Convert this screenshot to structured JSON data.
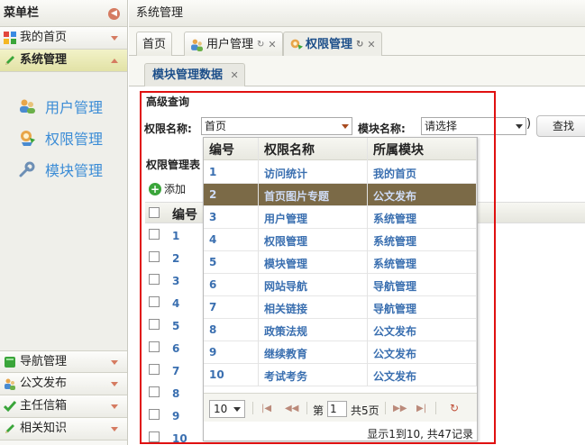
{
  "sidebar": {
    "title": "菜单栏",
    "sections": [
      {
        "label": "我的首页",
        "icon": "grid-icon"
      },
      {
        "label": "系统管理",
        "icon": "pencil-icon",
        "active": true
      }
    ],
    "sub_items": [
      {
        "label": "用户管理",
        "icon": "users-icon"
      },
      {
        "label": "权限管理",
        "icon": "permission-icon"
      },
      {
        "label": "模块管理",
        "icon": "wrench-icon"
      }
    ],
    "bottom_sections": [
      {
        "label": "导航管理",
        "icon": "book-icon"
      },
      {
        "label": "公文发布",
        "icon": "users-icon"
      },
      {
        "label": "主任信箱",
        "icon": "check-icon"
      },
      {
        "label": "相关知识",
        "icon": "pencil-icon"
      }
    ]
  },
  "main": {
    "title": "系统管理",
    "tabs": [
      {
        "label": "首页",
        "active": false
      },
      {
        "label": "用户管理",
        "active": false,
        "refresh": "↻",
        "close": "✕"
      },
      {
        "label": "权限管理",
        "active": true,
        "refresh": "↻",
        "close": "✕"
      }
    ],
    "subtab": {
      "label": "模块管理数据",
      "close": "✕"
    },
    "query": {
      "title": "高级查询",
      "permission_label": "权限名称:",
      "permission_value": "首页",
      "module_label": "模块名称:",
      "module_value": "请选择",
      "find_label": "查找"
    },
    "grid": {
      "title": "权限管理表",
      "add_label": "添加",
      "header_no": "编号",
      "row_numbers": [
        "1",
        "2",
        "3",
        "4",
        "5",
        "6",
        "7",
        "8",
        "9",
        "10"
      ]
    }
  },
  "dropdown": {
    "headers": [
      "编号",
      "权限名称",
      "所属模块"
    ],
    "rows": [
      {
        "id": "1",
        "name": "访问统计",
        "module": "我的首页"
      },
      {
        "id": "2",
        "name": "首页图片专题",
        "module": "公文发布",
        "selected": true
      },
      {
        "id": "3",
        "name": "用户管理",
        "module": "系统管理"
      },
      {
        "id": "4",
        "name": "权限管理",
        "module": "系统管理"
      },
      {
        "id": "5",
        "name": "模块管理",
        "module": "系统管理"
      },
      {
        "id": "6",
        "name": "网站导航",
        "module": "导航管理"
      },
      {
        "id": "7",
        "name": "相关链接",
        "module": "导航管理"
      },
      {
        "id": "8",
        "name": "政策法规",
        "module": "公文发布"
      },
      {
        "id": "9",
        "name": "继续教育",
        "module": "公文发布"
      },
      {
        "id": "10",
        "name": "考试考务",
        "module": "公文发布"
      }
    ],
    "pager": {
      "page_size": "10",
      "page_prefix": "第",
      "page_value": "1",
      "page_total": "共5页",
      "info": "显示1到10, 共47记录"
    }
  },
  "colors": {
    "accent": "#3b8cd6",
    "highlight_frame": "#e01010",
    "selected_row": "#7b6a47"
  }
}
